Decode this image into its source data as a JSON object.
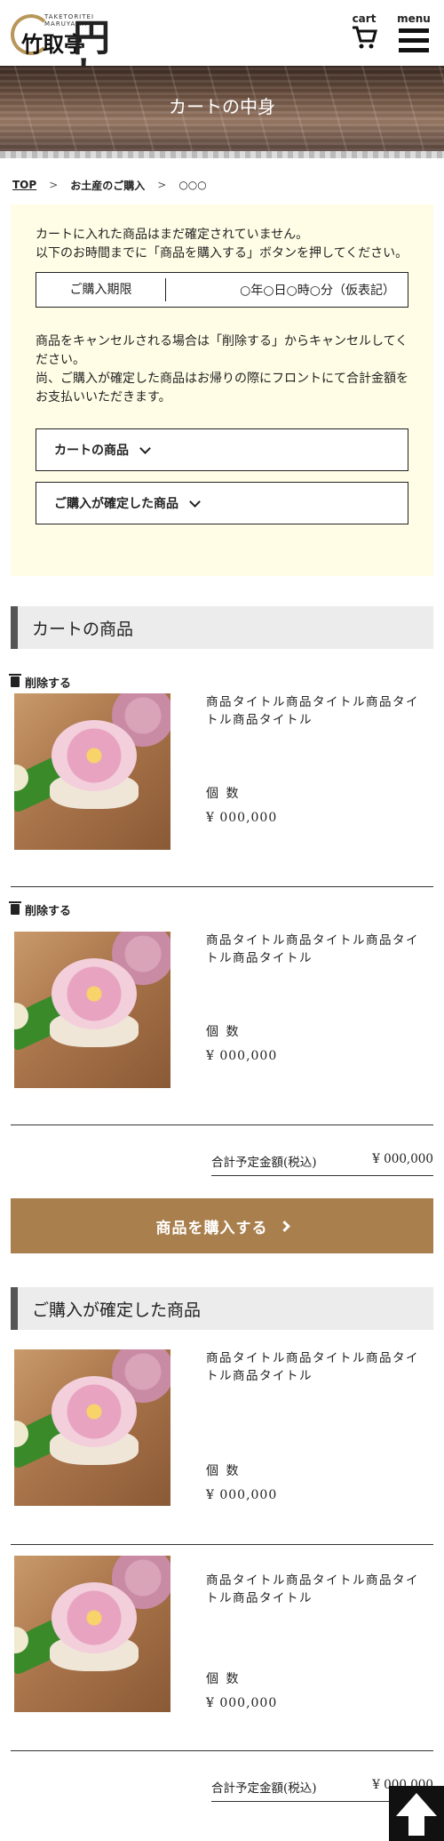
{
  "header": {
    "logo_sub": "TAKETORITEI  MARUYAMA",
    "logo_name": "竹取亭",
    "logo_mark": "円し",
    "cart_label": "cart",
    "menu_label": "menu"
  },
  "hero": {
    "title": "カートの中身"
  },
  "breadcrumb": {
    "items": [
      "TOP",
      "お土産のご購入",
      "○○○"
    ],
    "separator": ">"
  },
  "notice": {
    "line1": "カートに入れた商品はまだ確定されていません。",
    "line2": "以下のお時間までに「商品を購入する」ボタンを押してください。",
    "deadline_label": "ご購入期限",
    "deadline_value": "○年○日○時○分（仮表記）",
    "cancel_line1": "商品をキャンセルされる場合は「削除する」からキャンセルしてください。",
    "cancel_line2": "尚、ご購入が確定した商品はお帰りの際にフロントにて合計金額をお支払いいただきます。",
    "anchor_cart": "カートの商品",
    "anchor_confirmed": "ご購入が確定した商品"
  },
  "cart": {
    "title": "カートの商品",
    "delete_label": "削除する",
    "items": [
      {
        "name": "商品タイトル商品タイトル商品タイトル商品タイトル",
        "qty_label": "個 数",
        "price": "¥ 000,000"
      },
      {
        "name": "商品タイトル商品タイトル商品タイトル商品タイトル",
        "qty_label": "個 数",
        "price": "¥ 000,000"
      }
    ],
    "total_label": "合計予定金額(税込)",
    "total_value": "¥ 000,000",
    "buy_label": "商品を購入する"
  },
  "confirmed": {
    "title": "ご購入が確定した商品",
    "items": [
      {
        "name": "商品タイトル商品タイトル商品タイトル商品タイトル",
        "qty_label": "個 数",
        "price": "¥ 000,000"
      },
      {
        "name": "商品タイトル商品タイトル商品タイトル商品タイトル",
        "qty_label": "個 数",
        "price": "¥ 000,000"
      }
    ],
    "total_label": "合計予定金額(税込)",
    "total_value": "¥ 000,000"
  },
  "icons": {
    "cart": "cart-icon",
    "menu": "hamburger-menu-icon",
    "delete": "trash-icon",
    "page_top": "arrow-up-icon"
  },
  "colors": {
    "accent": "#a97f4d",
    "notice_bg": "#fffde5",
    "section_bg": "#ececec"
  }
}
